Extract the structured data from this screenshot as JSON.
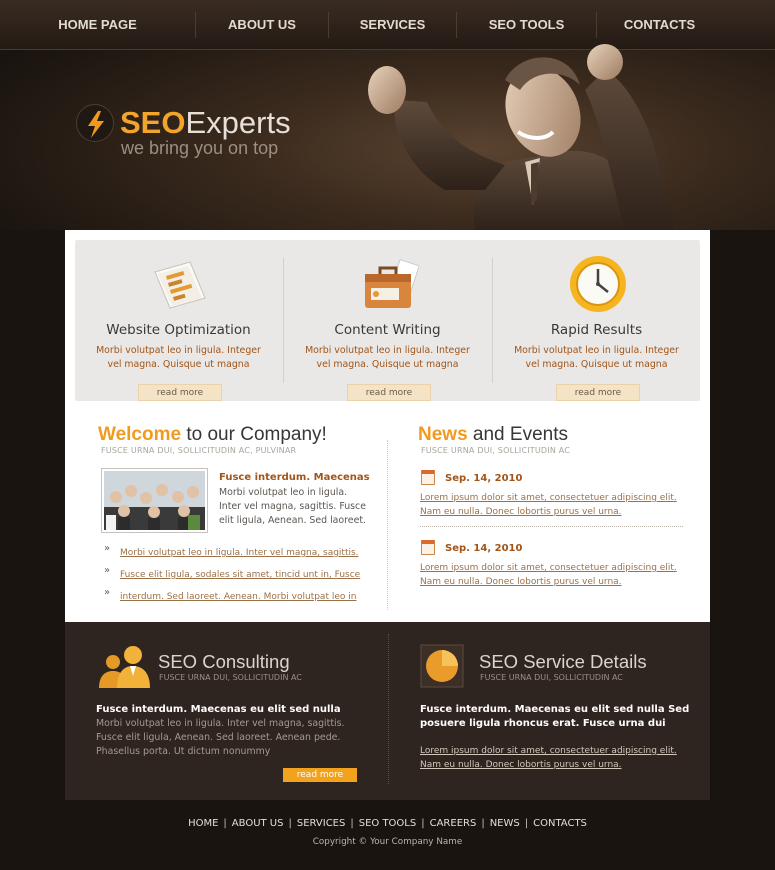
{
  "nav": [
    "HOME PAGE",
    "ABOUT US",
    "SERVICES",
    "SEO TOOLS",
    "CONTACTS"
  ],
  "logo": {
    "seo": "SEO",
    "experts": "Experts",
    "tagline": "we bring you on top"
  },
  "features": [
    {
      "title": "Website Optimization",
      "text": "Morbi volutpat leo in ligula. Integer vel magna. Quisque ut magna",
      "more": "read more",
      "icon": "chart-document-icon"
    },
    {
      "title": "Content Writing",
      "text": "Morbi volutpat leo in ligula. Integer vel magna. Quisque ut magna",
      "more": "read more",
      "icon": "briefcase-icon"
    },
    {
      "title": "Rapid Results",
      "text": "Morbi volutpat leo in ligula. Integer vel magna. Quisque ut magna",
      "more": "read more",
      "icon": "clock-icon"
    }
  ],
  "welcome": {
    "title_accent": "Welcome",
    "title_rest": " to our Company!",
    "subtitle": "FUSCE URNA DUI, SOLLICITUDIN AC, PULVINAR",
    "lead": "Fusce interdum. Maecenas",
    "text": "Morbi volutpat leo in ligula. Inter vel magna, sagittis. Fusce elit ligula,  Aenean. Sed laoreet.",
    "links": [
      "Morbi volutpat leo in ligula. Inter vel magna, sagittis.",
      "Fusce elit ligula, sodales sit amet, tincid unt in, Fusce",
      "interdum. Sed laoreet. Aenean. Morbi volutpat leo in"
    ]
  },
  "news": {
    "title_accent": "News",
    "title_rest": " and Events",
    "subtitle": "FUSCE URNA DUI, SOLLICITUDIN AC",
    "items": [
      {
        "date": "Sep. 14, 2010",
        "text": "Lorem ipsum dolor sit amet, consectetuer adipiscing elit. Nam eu nulla. Donec lobortis purus vel urna."
      },
      {
        "date": "Sep. 14, 2010",
        "text": "Lorem ipsum dolor sit amet, consectetuer adipiscing elit. Nam eu nulla. Donec lobortis purus vel urna."
      }
    ]
  },
  "consulting": {
    "title": "SEO Consulting",
    "subtitle": "FUSCE URNA DUI, SOLLICITUDIN AC",
    "lead": "Fusce interdum. Maecenas eu elit sed nulla",
    "text": "Morbi volutpat leo in ligula. Inter vel magna, sagittis. Fusce elit ligula,  Aenean. Sed laoreet. Aenean pede. Phasellus porta. Ut dictum nonummy",
    "button": "read more"
  },
  "service": {
    "title": "SEO Service Details",
    "subtitle": "FUSCE URNA DUI, SOLLICITUDIN AC",
    "lead": "Fusce interdum. Maecenas eu elit sed nulla Sed posuere ligula rhoncus erat. Fusce urna dui",
    "link": "Lorem ipsum dolor sit amet, consectetuer adipiscing elit. Nam eu nulla. Donec lobortis purus vel urna."
  },
  "footer": {
    "links": [
      "HOME",
      "ABOUT US",
      "SERVICES",
      "SEO TOOLS",
      "CAREERS",
      "NEWS",
      "CONTACTS"
    ],
    "copyright": "Copyright © Your Company Name"
  },
  "colors": {
    "accent": "#f29a1f",
    "brown_text": "#a1551a",
    "dark_panel": "#2f2520",
    "background": "#1a1410"
  }
}
